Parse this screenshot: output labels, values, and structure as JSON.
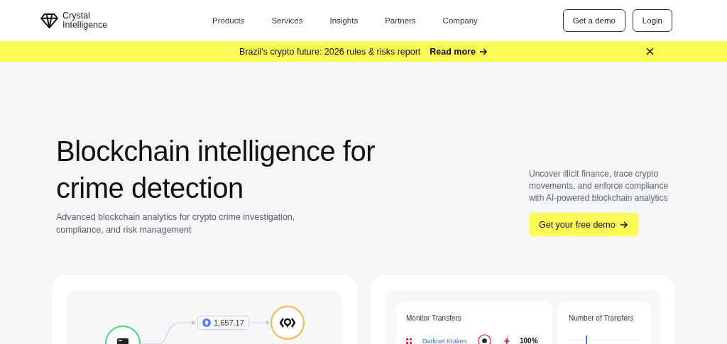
{
  "header": {
    "logo": [
      "Crystal",
      "Intelligence"
    ],
    "nav": [
      "Products",
      "Services",
      "Insights",
      "Partners",
      "Company"
    ],
    "buttons": [
      "Get a demo",
      "Login"
    ]
  },
  "banner": {
    "text": "Brazil's crypto future: 2026 rules & risks report",
    "link": "Read more"
  },
  "hero": {
    "title": "Blockchain intelligence for crime detection",
    "subtitle": "Advanced blockchain analytics for crypto crime investigation, compliance, and risk management",
    "side_text": "Uncover illicit finance, trace crypto movements, and enforce compliance with AI-powered blockchain analytics",
    "cta": "Get your free demo"
  },
  "graph_card": {
    "amount": "1,657.17"
  },
  "monitor_card": {
    "title": "Monitor Transfers",
    "rows": [
      {
        "name": "Darknet Kraken",
        "score": "100%"
      }
    ]
  },
  "transfers_card": {
    "title": "Number of Transfers"
  }
}
